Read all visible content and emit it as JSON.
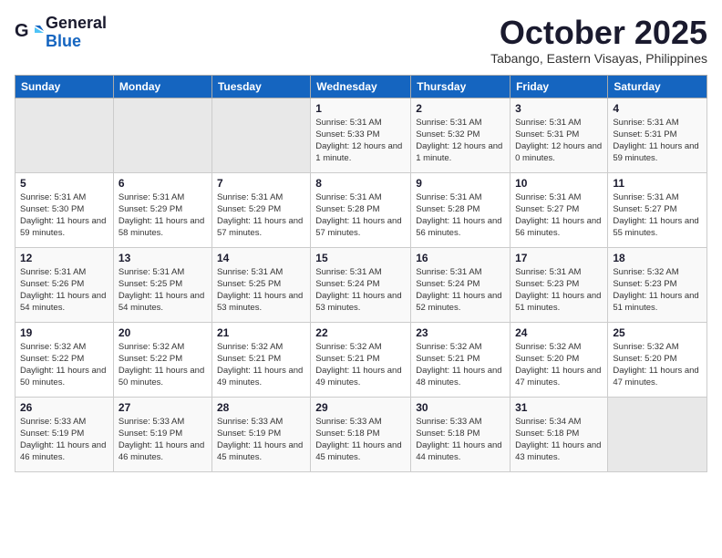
{
  "header": {
    "logo_general": "General",
    "logo_blue": "Blue",
    "month_title": "October 2025",
    "location": "Tabango, Eastern Visayas, Philippines"
  },
  "days_of_week": [
    "Sunday",
    "Monday",
    "Tuesday",
    "Wednesday",
    "Thursday",
    "Friday",
    "Saturday"
  ],
  "weeks": [
    [
      {
        "day": "",
        "info": ""
      },
      {
        "day": "",
        "info": ""
      },
      {
        "day": "",
        "info": ""
      },
      {
        "day": "1",
        "sunrise": "5:31 AM",
        "sunset": "5:33 PM",
        "daylight": "12 hours and 1 minute."
      },
      {
        "day": "2",
        "sunrise": "5:31 AM",
        "sunset": "5:32 PM",
        "daylight": "12 hours and 1 minute."
      },
      {
        "day": "3",
        "sunrise": "5:31 AM",
        "sunset": "5:31 PM",
        "daylight": "12 hours and 0 minutes."
      },
      {
        "day": "4",
        "sunrise": "5:31 AM",
        "sunset": "5:31 PM",
        "daylight": "11 hours and 59 minutes."
      }
    ],
    [
      {
        "day": "5",
        "sunrise": "5:31 AM",
        "sunset": "5:30 PM",
        "daylight": "11 hours and 59 minutes."
      },
      {
        "day": "6",
        "sunrise": "5:31 AM",
        "sunset": "5:29 PM",
        "daylight": "11 hours and 58 minutes."
      },
      {
        "day": "7",
        "sunrise": "5:31 AM",
        "sunset": "5:29 PM",
        "daylight": "11 hours and 57 minutes."
      },
      {
        "day": "8",
        "sunrise": "5:31 AM",
        "sunset": "5:28 PM",
        "daylight": "11 hours and 57 minutes."
      },
      {
        "day": "9",
        "sunrise": "5:31 AM",
        "sunset": "5:28 PM",
        "daylight": "11 hours and 56 minutes."
      },
      {
        "day": "10",
        "sunrise": "5:31 AM",
        "sunset": "5:27 PM",
        "daylight": "11 hours and 56 minutes."
      },
      {
        "day": "11",
        "sunrise": "5:31 AM",
        "sunset": "5:27 PM",
        "daylight": "11 hours and 55 minutes."
      }
    ],
    [
      {
        "day": "12",
        "sunrise": "5:31 AM",
        "sunset": "5:26 PM",
        "daylight": "11 hours and 54 minutes."
      },
      {
        "day": "13",
        "sunrise": "5:31 AM",
        "sunset": "5:25 PM",
        "daylight": "11 hours and 54 minutes."
      },
      {
        "day": "14",
        "sunrise": "5:31 AM",
        "sunset": "5:25 PM",
        "daylight": "11 hours and 53 minutes."
      },
      {
        "day": "15",
        "sunrise": "5:31 AM",
        "sunset": "5:24 PM",
        "daylight": "11 hours and 53 minutes."
      },
      {
        "day": "16",
        "sunrise": "5:31 AM",
        "sunset": "5:24 PM",
        "daylight": "11 hours and 52 minutes."
      },
      {
        "day": "17",
        "sunrise": "5:31 AM",
        "sunset": "5:23 PM",
        "daylight": "11 hours and 51 minutes."
      },
      {
        "day": "18",
        "sunrise": "5:32 AM",
        "sunset": "5:23 PM",
        "daylight": "11 hours and 51 minutes."
      }
    ],
    [
      {
        "day": "19",
        "sunrise": "5:32 AM",
        "sunset": "5:22 PM",
        "daylight": "11 hours and 50 minutes."
      },
      {
        "day": "20",
        "sunrise": "5:32 AM",
        "sunset": "5:22 PM",
        "daylight": "11 hours and 50 minutes."
      },
      {
        "day": "21",
        "sunrise": "5:32 AM",
        "sunset": "5:21 PM",
        "daylight": "11 hours and 49 minutes."
      },
      {
        "day": "22",
        "sunrise": "5:32 AM",
        "sunset": "5:21 PM",
        "daylight": "11 hours and 49 minutes."
      },
      {
        "day": "23",
        "sunrise": "5:32 AM",
        "sunset": "5:21 PM",
        "daylight": "11 hours and 48 minutes."
      },
      {
        "day": "24",
        "sunrise": "5:32 AM",
        "sunset": "5:20 PM",
        "daylight": "11 hours and 47 minutes."
      },
      {
        "day": "25",
        "sunrise": "5:32 AM",
        "sunset": "5:20 PM",
        "daylight": "11 hours and 47 minutes."
      }
    ],
    [
      {
        "day": "26",
        "sunrise": "5:33 AM",
        "sunset": "5:19 PM",
        "daylight": "11 hours and 46 minutes."
      },
      {
        "day": "27",
        "sunrise": "5:33 AM",
        "sunset": "5:19 PM",
        "daylight": "11 hours and 46 minutes."
      },
      {
        "day": "28",
        "sunrise": "5:33 AM",
        "sunset": "5:19 PM",
        "daylight": "11 hours and 45 minutes."
      },
      {
        "day": "29",
        "sunrise": "5:33 AM",
        "sunset": "5:18 PM",
        "daylight": "11 hours and 45 minutes."
      },
      {
        "day": "30",
        "sunrise": "5:33 AM",
        "sunset": "5:18 PM",
        "daylight": "11 hours and 44 minutes."
      },
      {
        "day": "31",
        "sunrise": "5:34 AM",
        "sunset": "5:18 PM",
        "daylight": "11 hours and 43 minutes."
      },
      {
        "day": "",
        "info": ""
      }
    ]
  ],
  "labels": {
    "sunrise": "Sunrise:",
    "sunset": "Sunset:",
    "daylight": "Daylight:"
  }
}
